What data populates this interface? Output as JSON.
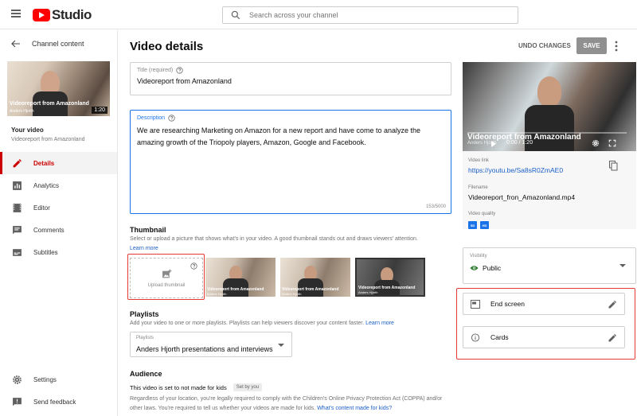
{
  "app": {
    "name": "Studio"
  },
  "search": {
    "placeholder": "Search across your channel"
  },
  "sidebar": {
    "back_label": "Channel content",
    "thumb": {
      "title": "Videoreport from Amazonland",
      "author": "Anders Hjorth",
      "duration": "1:20"
    },
    "your_video_label": "Your video",
    "your_video_title": "Videoreport from Amazonland",
    "items": [
      {
        "label": "Details",
        "icon": "pencil-icon",
        "active": true
      },
      {
        "label": "Analytics",
        "icon": "analytics-icon"
      },
      {
        "label": "Editor",
        "icon": "film-icon"
      },
      {
        "label": "Comments",
        "icon": "comment-icon"
      },
      {
        "label": "Subtitles",
        "icon": "subtitles-icon"
      }
    ],
    "bottom": [
      {
        "label": "Settings",
        "icon": "gear-icon"
      },
      {
        "label": "Send feedback",
        "icon": "feedback-icon"
      }
    ]
  },
  "header": {
    "title": "Video details",
    "undo_label": "UNDO CHANGES",
    "save_label": "SAVE"
  },
  "form": {
    "title_label": "Title (required)",
    "title_value": "Videoreport from Amazonland",
    "description_label": "Description",
    "description_value": "We are researching Marketing on Amazon for a new report and have come to analyze the amazing growth of the Triopoly players, Amazon, Google and Facebook.",
    "description_count": "153/5000",
    "thumbnail": {
      "title": "Thumbnail",
      "desc": "Select or upload a picture that shows what's in your video. A good thumbnail stands out and draws viewers' attention.",
      "learn_more": "Learn more",
      "upload_label": "Upload thumbnail",
      "thumb_title": "Videoreport from Amazonland",
      "thumb_author": "Anders Hjorth"
    },
    "playlists": {
      "title": "Playlists",
      "desc": "Add your video to one or more playlists. Playlists can help viewers discover your content faster.",
      "learn_more": "Learn more",
      "select_label": "Playlists",
      "select_value": "Anders Hjorth presentations and interviews"
    },
    "audience": {
      "title": "Audience",
      "status": "This video is set to not made for kids",
      "chip": "Set by you",
      "para": "Regardless of your location, you're legally required to comply with the Children's Online Privacy Protection Act (COPPA) and/or other laws. You're required to tell us whether your videos are made for kids.",
      "link": "What's content made for kids?"
    }
  },
  "right": {
    "player": {
      "title": "Videoreport from Amazonland",
      "author": "Anders Hjorth",
      "time": "0:00 / 1:20"
    },
    "video_link_label": "Video link",
    "video_link": "https://youtu.be/Sa8sR0ZmAE0",
    "filename_label": "Filename",
    "filename": "Videoreport_fron_Amazonland.mp4",
    "quality_label": "Video quality",
    "quality_badges": [
      "SD",
      "HD"
    ],
    "visibility_label": "Visibility",
    "visibility_value": "Public",
    "end_screen_label": "End screen",
    "cards_label": "Cards"
  },
  "colors": {
    "accent": "#cc0000",
    "link": "#1a5fc8",
    "focus": "#1a73e8",
    "highlight": "#e53935"
  }
}
